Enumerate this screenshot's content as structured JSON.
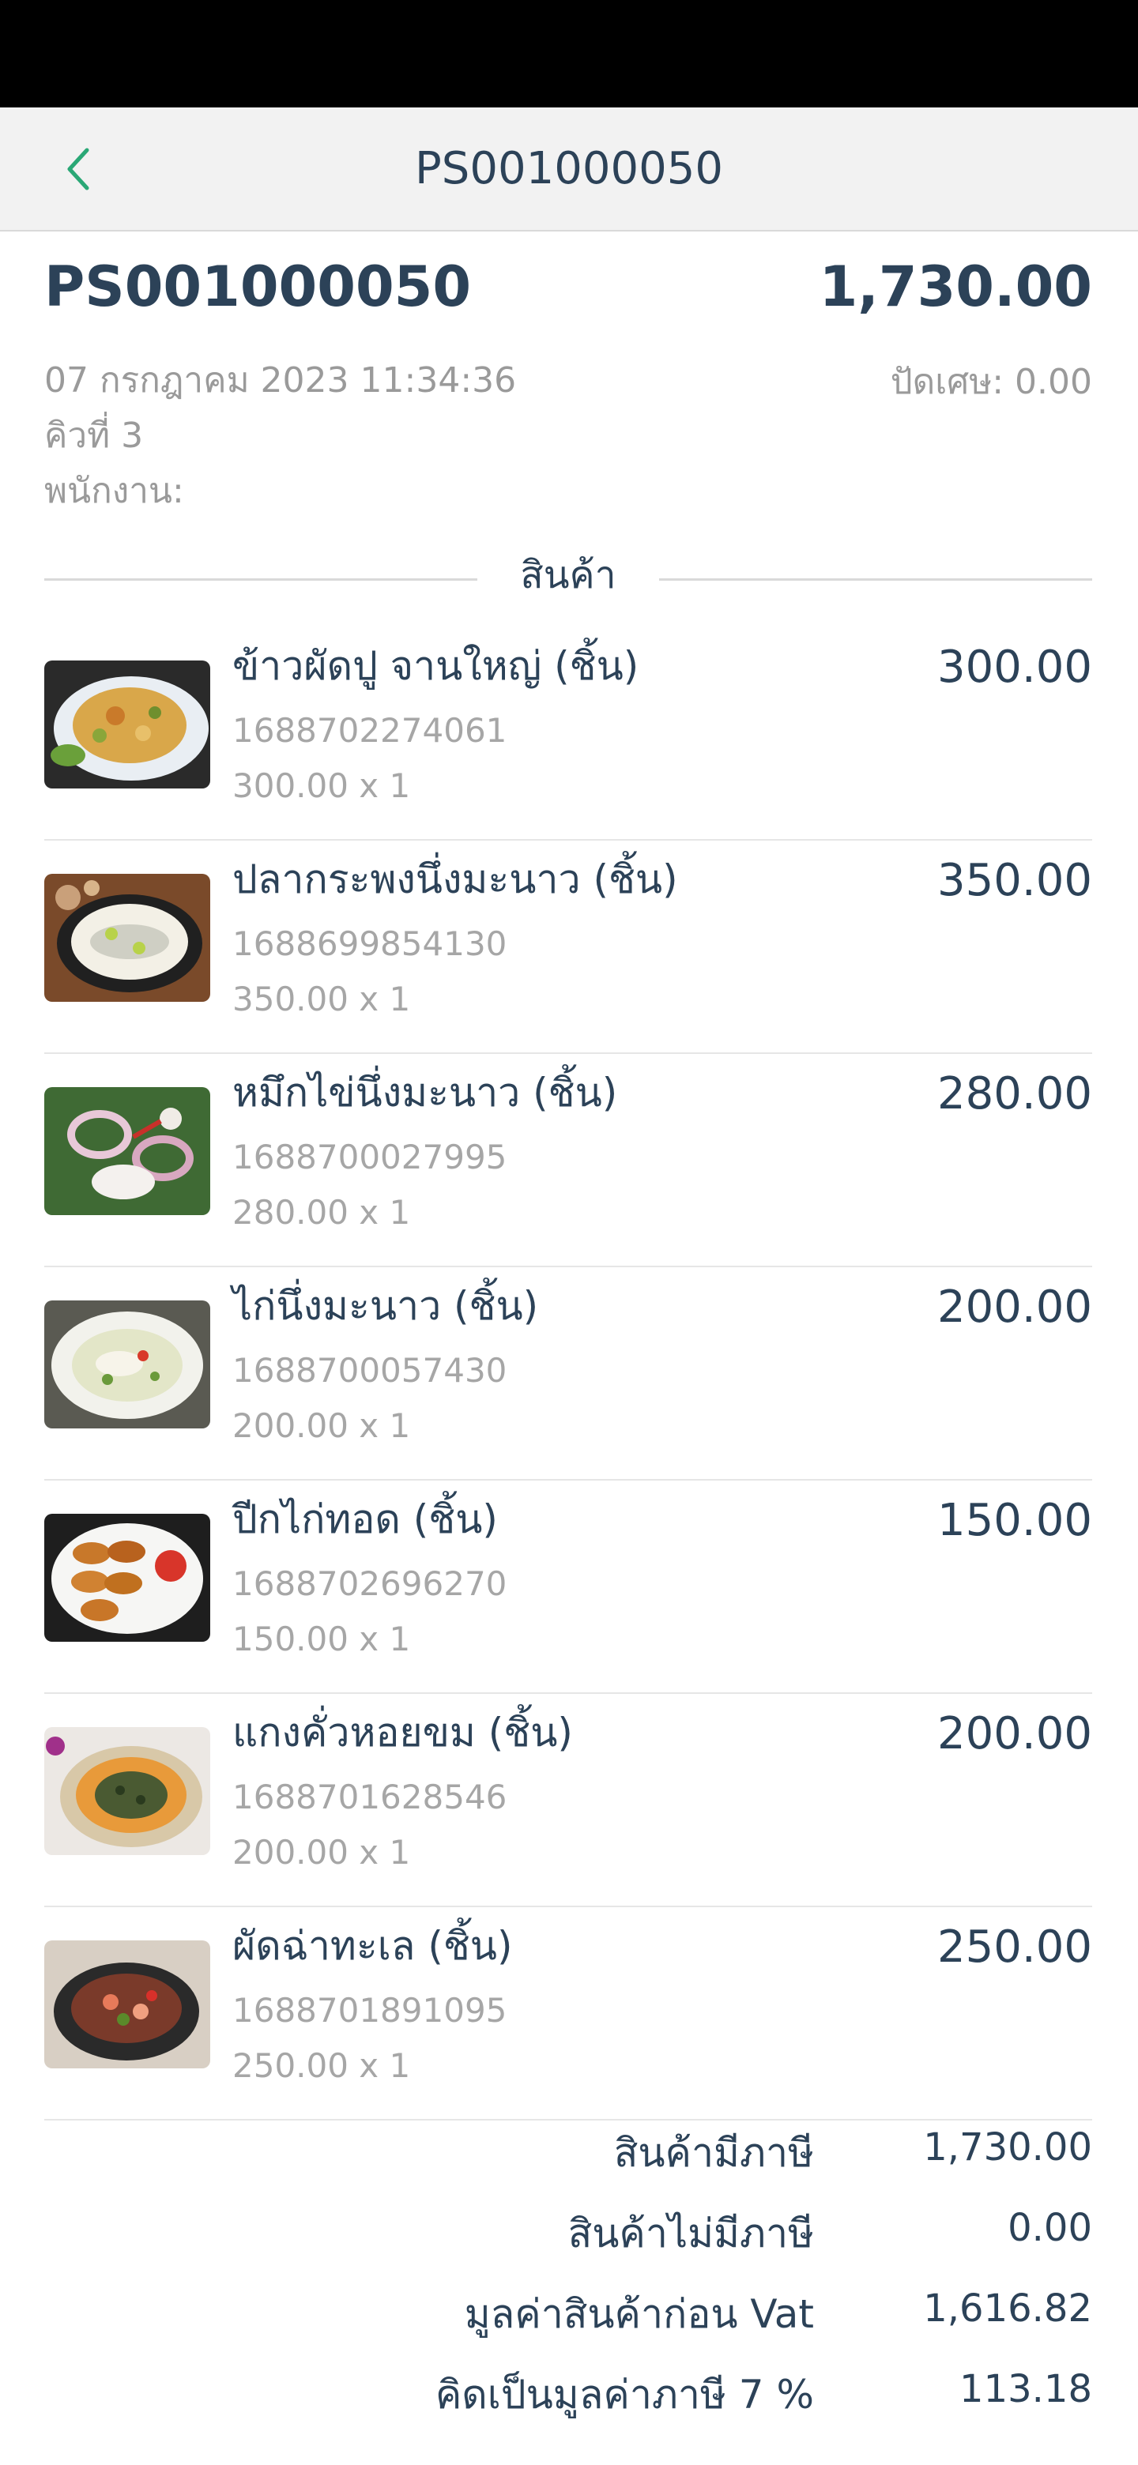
{
  "header": {
    "title": "PS001000050"
  },
  "bill": {
    "number": "PS001000050",
    "total": "1,730.00",
    "datetime": "07 กรกฎาคม 2023 11:34:36",
    "queue": "คิวที่ 3",
    "staff": "พนักงาน:",
    "rounding": "ปัดเศษ: 0.00"
  },
  "section": {
    "products_label": "สินค้า"
  },
  "items": [
    {
      "name": "ข้าวผัดปู จานใหญ่  (ชิ้น)",
      "code": "1688702274061",
      "qty": "300.00 x 1",
      "price": "300.00",
      "image": "crab-fried-rice-image"
    },
    {
      "name": "ปลากระพงนึ่งมะนาว  (ชิ้น)",
      "code": "1688699854130",
      "qty": "350.00 x 1",
      "price": "350.00",
      "image": "steamed-fish-image"
    },
    {
      "name": "หมึกไข่นึ่งมะนาว  (ชิ้น)",
      "code": "1688700027995",
      "qty": "280.00 x 1",
      "price": "280.00",
      "image": "squid-salad-image"
    },
    {
      "name": "ไก่นึ่งมะนาว  (ชิ้น)",
      "code": "1688700057430",
      "qty": "200.00 x 1",
      "price": "200.00",
      "image": "lime-chicken-image"
    },
    {
      "name": "ปีกไก่ทอด  (ชิ้น)",
      "code": "1688702696270",
      "qty": "150.00 x 1",
      "price": "150.00",
      "image": "fried-wings-image"
    },
    {
      "name": "แกงคั่วหอยขม  (ชิ้น)",
      "code": "1688701628546",
      "qty": "200.00 x 1",
      "price": "200.00",
      "image": "snail-curry-image"
    },
    {
      "name": "ผัดฉ่าทะเล  (ชิ้น)",
      "code": "1688701891095",
      "qty": "250.00 x 1",
      "price": "250.00",
      "image": "seafood-stirfry-image"
    }
  ],
  "summary": [
    {
      "label": "สินค้ามีภาษี",
      "value": "1,730.00"
    },
    {
      "label": "สินค้าไม่มีภาษี",
      "value": "0.00"
    },
    {
      "label": "มูลค่าสินค้าก่อน Vat",
      "value": "1,616.82"
    },
    {
      "label": "คิดเป็นมูลค่าภาษี 7 %",
      "value": "113.18"
    }
  ],
  "icons": {
    "back": "chevron-left-icon"
  },
  "colors": {
    "accent": "#2aa876",
    "text": "#2c4258",
    "muted": "#9a9a9a"
  }
}
